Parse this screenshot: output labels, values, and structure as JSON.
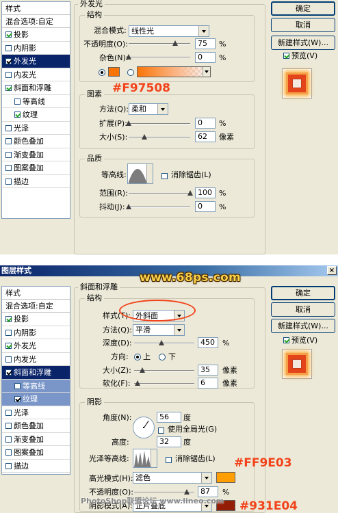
{
  "top": {
    "list_header": "样式",
    "list_blend": "混合选项:自定",
    "list_items": [
      {
        "label": "投影",
        "checked": true
      },
      {
        "label": "内阴影",
        "checked": false
      },
      {
        "label": "外发光",
        "checked": true
      },
      {
        "label": "内发光",
        "checked": false
      },
      {
        "label": "斜面和浮雕",
        "checked": true
      },
      {
        "label": "等高线",
        "checked": false
      },
      {
        "label": "纹理",
        "checked": true
      },
      {
        "label": "光泽",
        "checked": false
      },
      {
        "label": "颜色叠加",
        "checked": false
      },
      {
        "label": "渐变叠加",
        "checked": false
      },
      {
        "label": "图案叠加",
        "checked": false
      },
      {
        "label": "描边",
        "checked": false
      }
    ],
    "section_title": "外发光",
    "structure": {
      "title": "结构",
      "blend_mode_label": "混合模式:",
      "blend_mode_value": "线性光",
      "opacity_label": "不透明度(O):",
      "opacity_value": "75",
      "noise_label": "杂色(N):",
      "noise_value": "0",
      "unit_pct": "%",
      "color_hex": "#f97508"
    },
    "elements": {
      "title": "图素",
      "method_label": "方法(Q):",
      "method_value": "柔和",
      "spread_label": "扩展(P):",
      "spread_value": "0",
      "size_label": "大小(S):",
      "size_value": "62",
      "unit_px": "像素",
      "unit_pct": "%"
    },
    "quality": {
      "title": "品质",
      "contour_label": "等高线:",
      "antialias_label": "消除锯齿(L)",
      "range_label": "范围(R):",
      "range_value": "100",
      "jitter_label": "抖动(J):",
      "jitter_value": "0",
      "unit_pct": "%"
    },
    "buttons": {
      "ok": "确定",
      "cancel": "取消",
      "new_style": "新建样式(W)...",
      "preview": "预览(V)"
    },
    "annotation": "#F97508"
  },
  "bottom": {
    "window_title": "图层样式",
    "watermark": "www.68ps.com",
    "list_header": "样式",
    "list_blend": "混合选项:自定",
    "list_items": [
      {
        "label": "投影",
        "checked": true
      },
      {
        "label": "内阴影",
        "checked": false
      },
      {
        "label": "外发光",
        "checked": true
      },
      {
        "label": "内发光",
        "checked": false
      },
      {
        "label": "斜面和浮雕",
        "checked": true
      },
      {
        "label": "等高线",
        "checked": false
      },
      {
        "label": "纹理",
        "checked": true
      },
      {
        "label": "光泽",
        "checked": false
      },
      {
        "label": "颜色叠加",
        "checked": false
      },
      {
        "label": "渐变叠加",
        "checked": false
      },
      {
        "label": "图案叠加",
        "checked": false
      },
      {
        "label": "描边",
        "checked": false
      }
    ],
    "section_title": "斜面和浮雕",
    "structure": {
      "title": "结构",
      "style_label": "样式(T):",
      "style_value": "外斜面",
      "technique_label": "方法(Q):",
      "technique_value": "平滑",
      "depth_label": "深度(D):",
      "depth_value": "450",
      "direction_label": "方向:",
      "dir_up": "上",
      "dir_down": "下",
      "size_label": "大小(Z):",
      "size_value": "35",
      "soften_label": "软化(F):",
      "soften_value": "6",
      "unit_px": "像素",
      "unit_pct": "%"
    },
    "shading": {
      "title": "阴影",
      "angle_label": "角度(N):",
      "angle_value": "56",
      "unit_deg": "度",
      "global_light_label": "使用全局光(G)",
      "altitude_label": "高度:",
      "altitude_value": "32",
      "gloss_contour_label": "光泽等高线:",
      "antialias_label": "消除锯齿(L)",
      "highlight_mode_label": "高光模式(H):",
      "highlight_mode_value": "滤色",
      "highlight_color": "#ff9e03",
      "opacity_label": "不透明度(O):",
      "opacity_value": "87",
      "unit_pct": "%",
      "shadow_mode_label": "阴影模式(A):",
      "shadow_mode_value": "正片叠底"
    },
    "buttons": {
      "ok": "确定",
      "cancel": "取消",
      "new_style": "新建样式(W)...",
      "preview": "预览(V)"
    },
    "annotation_1": "#FF9E03",
    "annotation_2": "#931E04",
    "footer_watermark": "PhotoShop联盟论坛 www.lineo.com"
  }
}
